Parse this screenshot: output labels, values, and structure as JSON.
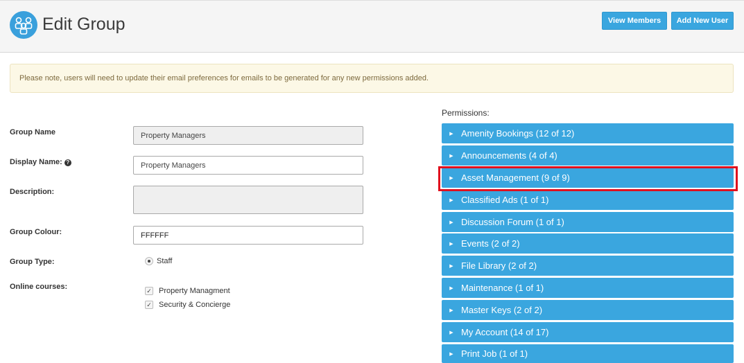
{
  "header": {
    "title": "Edit Group",
    "view_members_label": "View Members",
    "add_new_user_label": "Add New User"
  },
  "notice": "Please note, users will need to update their email preferences for emails to be generated for any new permissions added.",
  "form": {
    "group_name_label": "Group Name",
    "group_name_value": "Property Managers",
    "display_name_label": "Display Name:",
    "display_name_value": "Property Managers",
    "description_label": "Description:",
    "description_value": "",
    "group_colour_label": "Group Colour:",
    "group_colour_value": "FFFFFF",
    "group_type_label": "Group Type:",
    "group_type_option": "Staff",
    "online_courses_label": "Online courses:",
    "courses": [
      "Property Managment",
      "Security & Concierge"
    ]
  },
  "permissions": {
    "label": "Permissions:",
    "items": [
      "Amenity Bookings (12 of 12)",
      "Announcements (4 of 4)",
      "Asset Management (9 of 9)",
      "Classified Ads (1 of 1)",
      "Discussion Forum (1 of 1)",
      "Events (2 of 2)",
      "File Library (2 of 2)",
      "Maintenance (1 of 1)",
      "Master Keys (2 of 2)",
      "My Account (14 of 17)",
      "Print Job (1 of 1)"
    ]
  },
  "colors": {
    "accent": "#3aa6df",
    "highlight": "#e0101e",
    "notice_bg": "#fcf8e6"
  }
}
